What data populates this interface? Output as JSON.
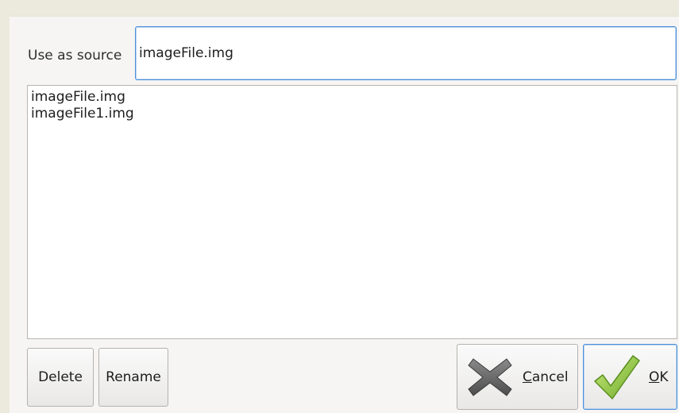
{
  "source": {
    "label": "Use as source",
    "value": "imageFile.img"
  },
  "files": [
    "imageFile.img",
    "imageFile1.img"
  ],
  "buttons": {
    "delete": "Delete",
    "rename": "Rename",
    "cancel_first": "C",
    "cancel_rest": "ancel",
    "ok_first": "O",
    "ok_rest": "K",
    "cancel_icon": "cross-icon",
    "ok_icon": "checkmark-icon"
  },
  "colors": {
    "focus": "#4a90d9",
    "checkmark": "#8cc63f",
    "cross": "#6b6b6b"
  }
}
